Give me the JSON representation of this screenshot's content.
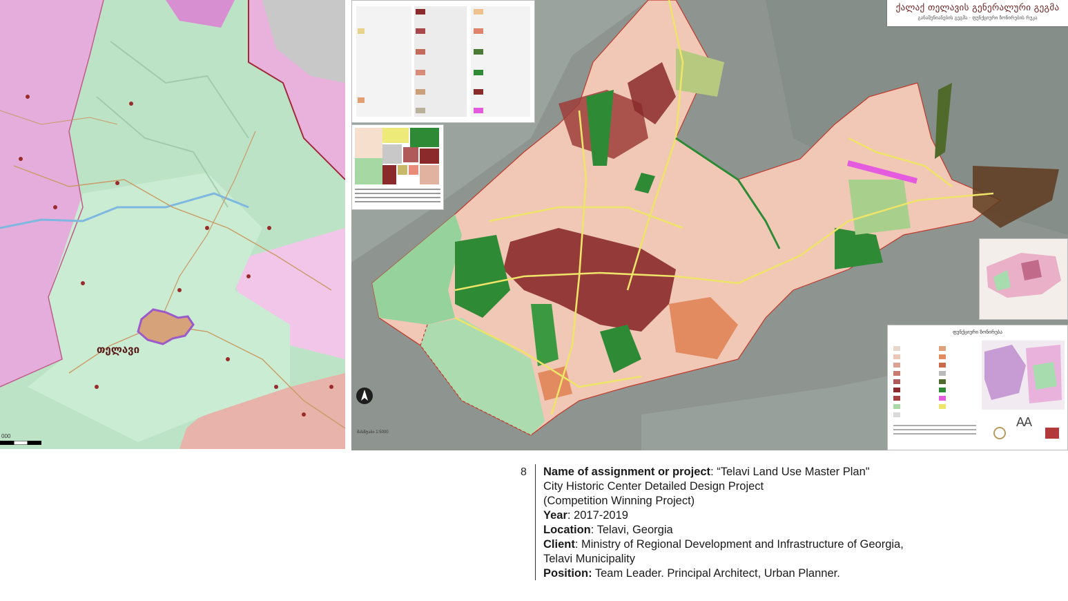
{
  "regional_map": {
    "city_label": "თელავი",
    "scale_label": "000"
  },
  "master_plan": {
    "title": "ქალაქ თელავის გენერალური გეგმა",
    "subtitle": "განაშენიანების გეგმა · ფუნქციური ზონირების რუკა",
    "legend_title": "ფუნქციური ზონირება",
    "logo_text": "AA",
    "scale_note": "მასშტაბი 1:5000"
  },
  "caption": {
    "number": "8",
    "project_label": "Name of assignment or project",
    "project_value": ": “Telavi Land Use Master Plan\"",
    "project_line2": "City Historic Center Detailed Design Project",
    "project_line3": "(Competition Winning Project)",
    "year_label": "Year",
    "year_value": ": 2017-2019",
    "location_label": "Location",
    "location_value": ": Telavi, Georgia",
    "client_label": "Client",
    "client_value": ": Ministry of Regional Development and Infrastructure of Georgia,",
    "client_line2": "Telavi Municipality",
    "position_label": "Position:",
    "position_value": " Team Leader. Principal Architect, Urban Planner."
  },
  "colors": {
    "regional_green": "#b9e2c4",
    "regional_pink": "#e7a9d9",
    "historic_maroon": "#8a2a2a",
    "green_space": "#2f8a36",
    "road_yellow": "#efe46a",
    "residential_pink": "#f1c9b9"
  }
}
